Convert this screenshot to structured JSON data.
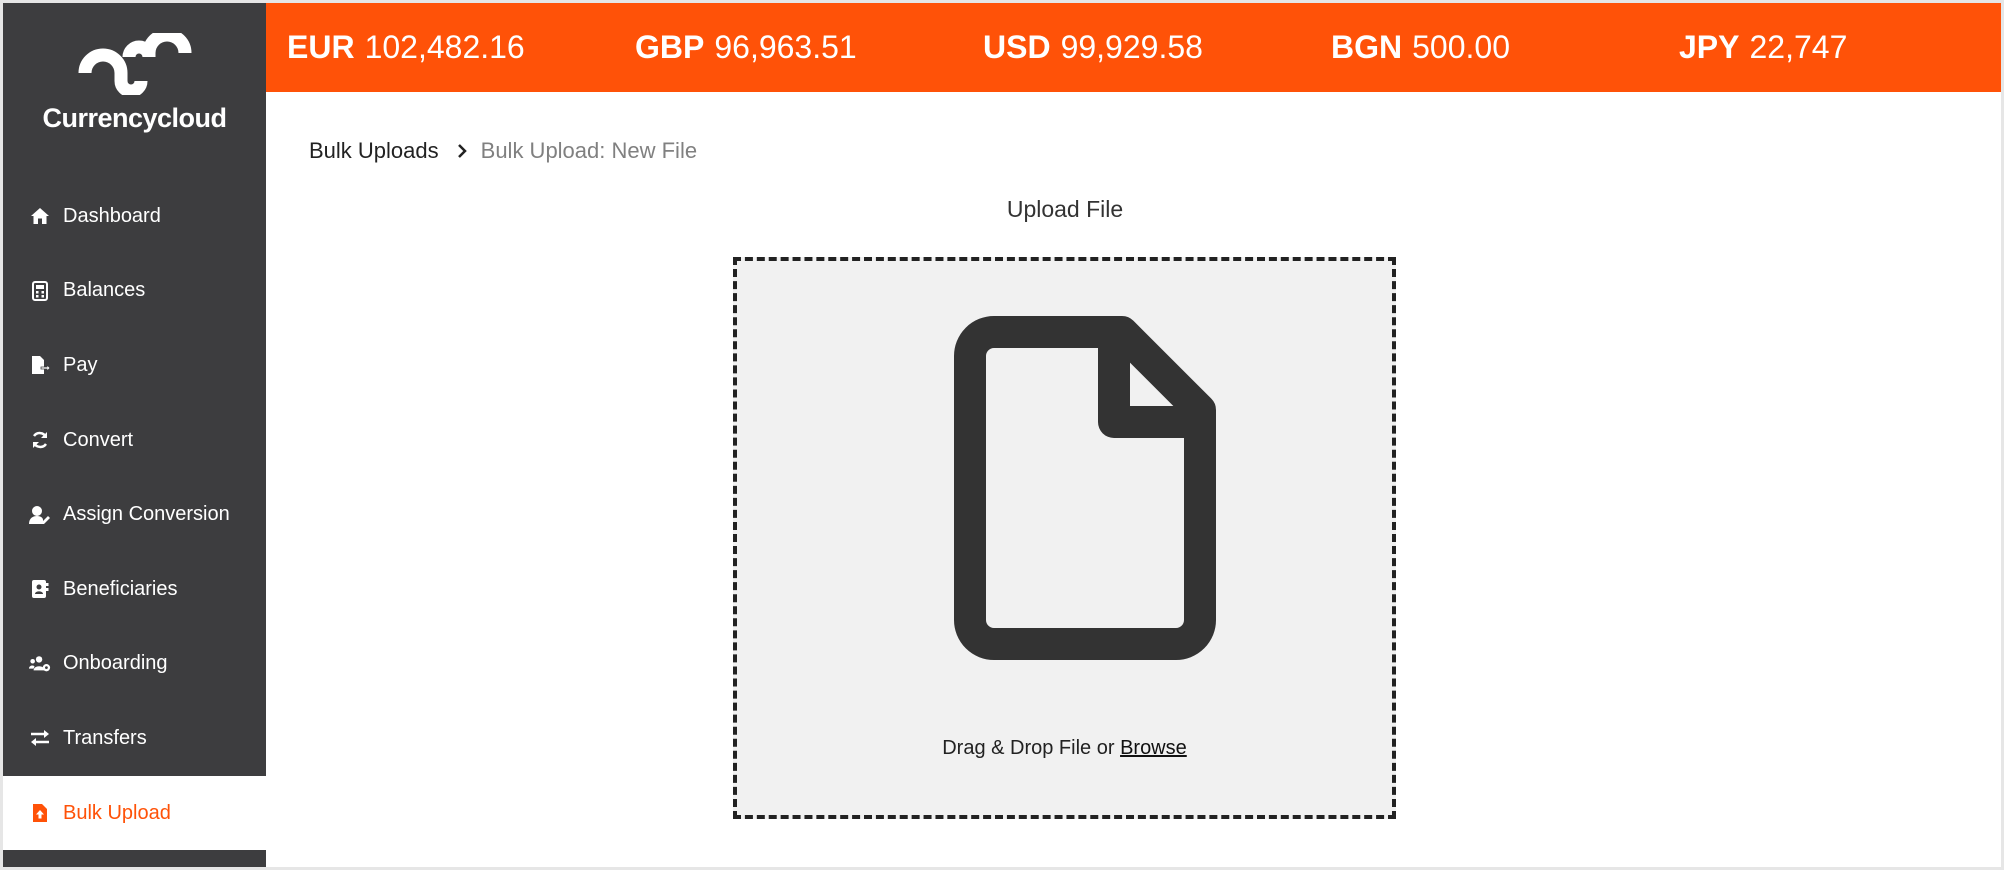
{
  "brand": {
    "name": "Currencycloud",
    "accent_color": "#ff5208",
    "sidebar_color": "#3d3d3f"
  },
  "balances": [
    {
      "code": "EUR",
      "amount": "102,482.16"
    },
    {
      "code": "GBP",
      "amount": "96,963.51"
    },
    {
      "code": "USD",
      "amount": "99,929.58"
    },
    {
      "code": "BGN",
      "amount": "500.00"
    },
    {
      "code": "JPY",
      "amount": "22,747"
    }
  ],
  "sidebar": {
    "items": [
      {
        "label": "Dashboard",
        "icon": "home-icon"
      },
      {
        "label": "Balances",
        "icon": "calculator-icon"
      },
      {
        "label": "Pay",
        "icon": "file-export-icon"
      },
      {
        "label": "Convert",
        "icon": "sync-icon"
      },
      {
        "label": "Assign Conversion",
        "icon": "user-edit-icon"
      },
      {
        "label": "Beneficiaries",
        "icon": "address-book-icon"
      },
      {
        "label": "Onboarding",
        "icon": "users-cog-icon"
      },
      {
        "label": "Transfers",
        "icon": "exchange-icon"
      },
      {
        "label": "Bulk Upload",
        "icon": "file-upload-icon",
        "active": true
      }
    ]
  },
  "breadcrumb": {
    "parent": "Bulk Uploads",
    "current": "Bulk Upload: New File"
  },
  "upload": {
    "title": "Upload File",
    "drop_text": "Drag & Drop File or",
    "browse_label": "Browse"
  }
}
